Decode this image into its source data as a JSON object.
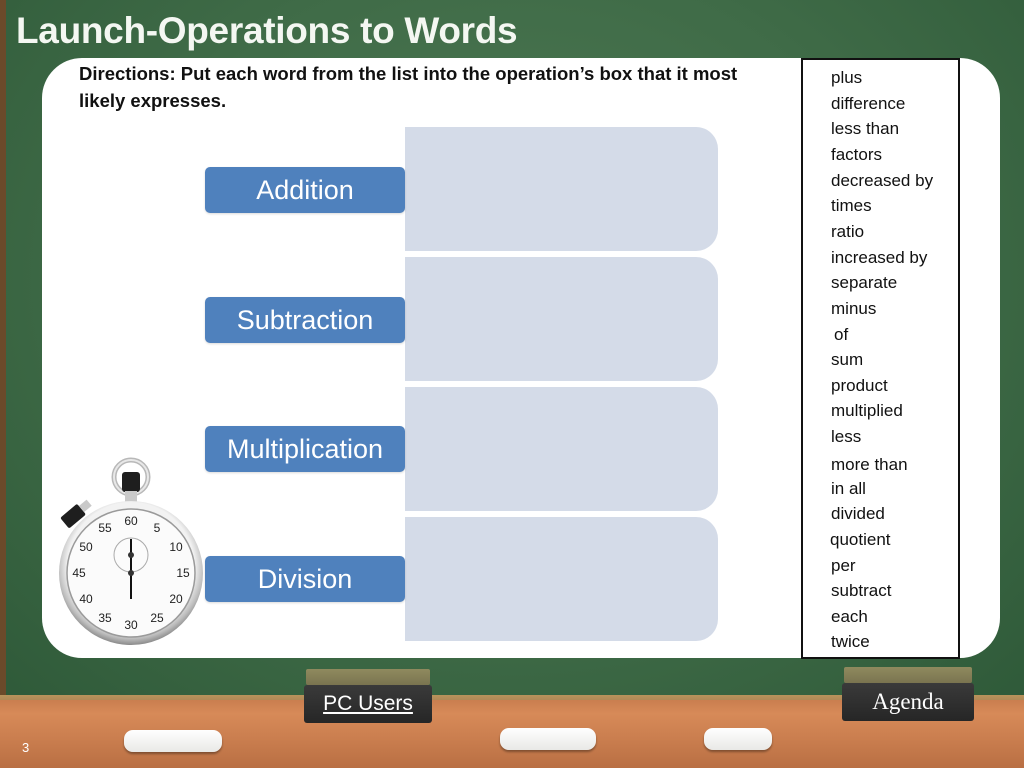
{
  "slide": {
    "title": "Launch-Operations to Words",
    "directions": "Directions: Put each word from the list into the operation’s box that it most likely expresses.",
    "slide_number": "3"
  },
  "operations": [
    {
      "label": "Addition"
    },
    {
      "label": "Subtraction"
    },
    {
      "label": "Multiplication"
    },
    {
      "label": "Division"
    }
  ],
  "word_list": [
    "plus",
    "difference",
    "less than",
    "factors",
    "decreased by",
    "times",
    "ratio",
    "increased by",
    "separate",
    "minus",
    "of",
    "sum",
    "product",
    "multiplied",
    "less",
    "more than",
    "in all",
    "divided",
    "quotient",
    "per",
    "subtract",
    "each",
    "twice"
  ],
  "nav": {
    "pc_users": "PC Users",
    "agenda": "Agenda"
  },
  "stopwatch": {
    "icon": "stopwatch-icon",
    "dial_numbers": [
      "60",
      "5",
      "10",
      "15",
      "20",
      "25",
      "30",
      "35",
      "40",
      "45",
      "50",
      "55"
    ]
  },
  "colors": {
    "board_green": "#3f6b47",
    "op_label_blue": "#4f81bd",
    "op_box_fill": "#d4dbe8",
    "ledge_wood": "#c97e4f"
  }
}
